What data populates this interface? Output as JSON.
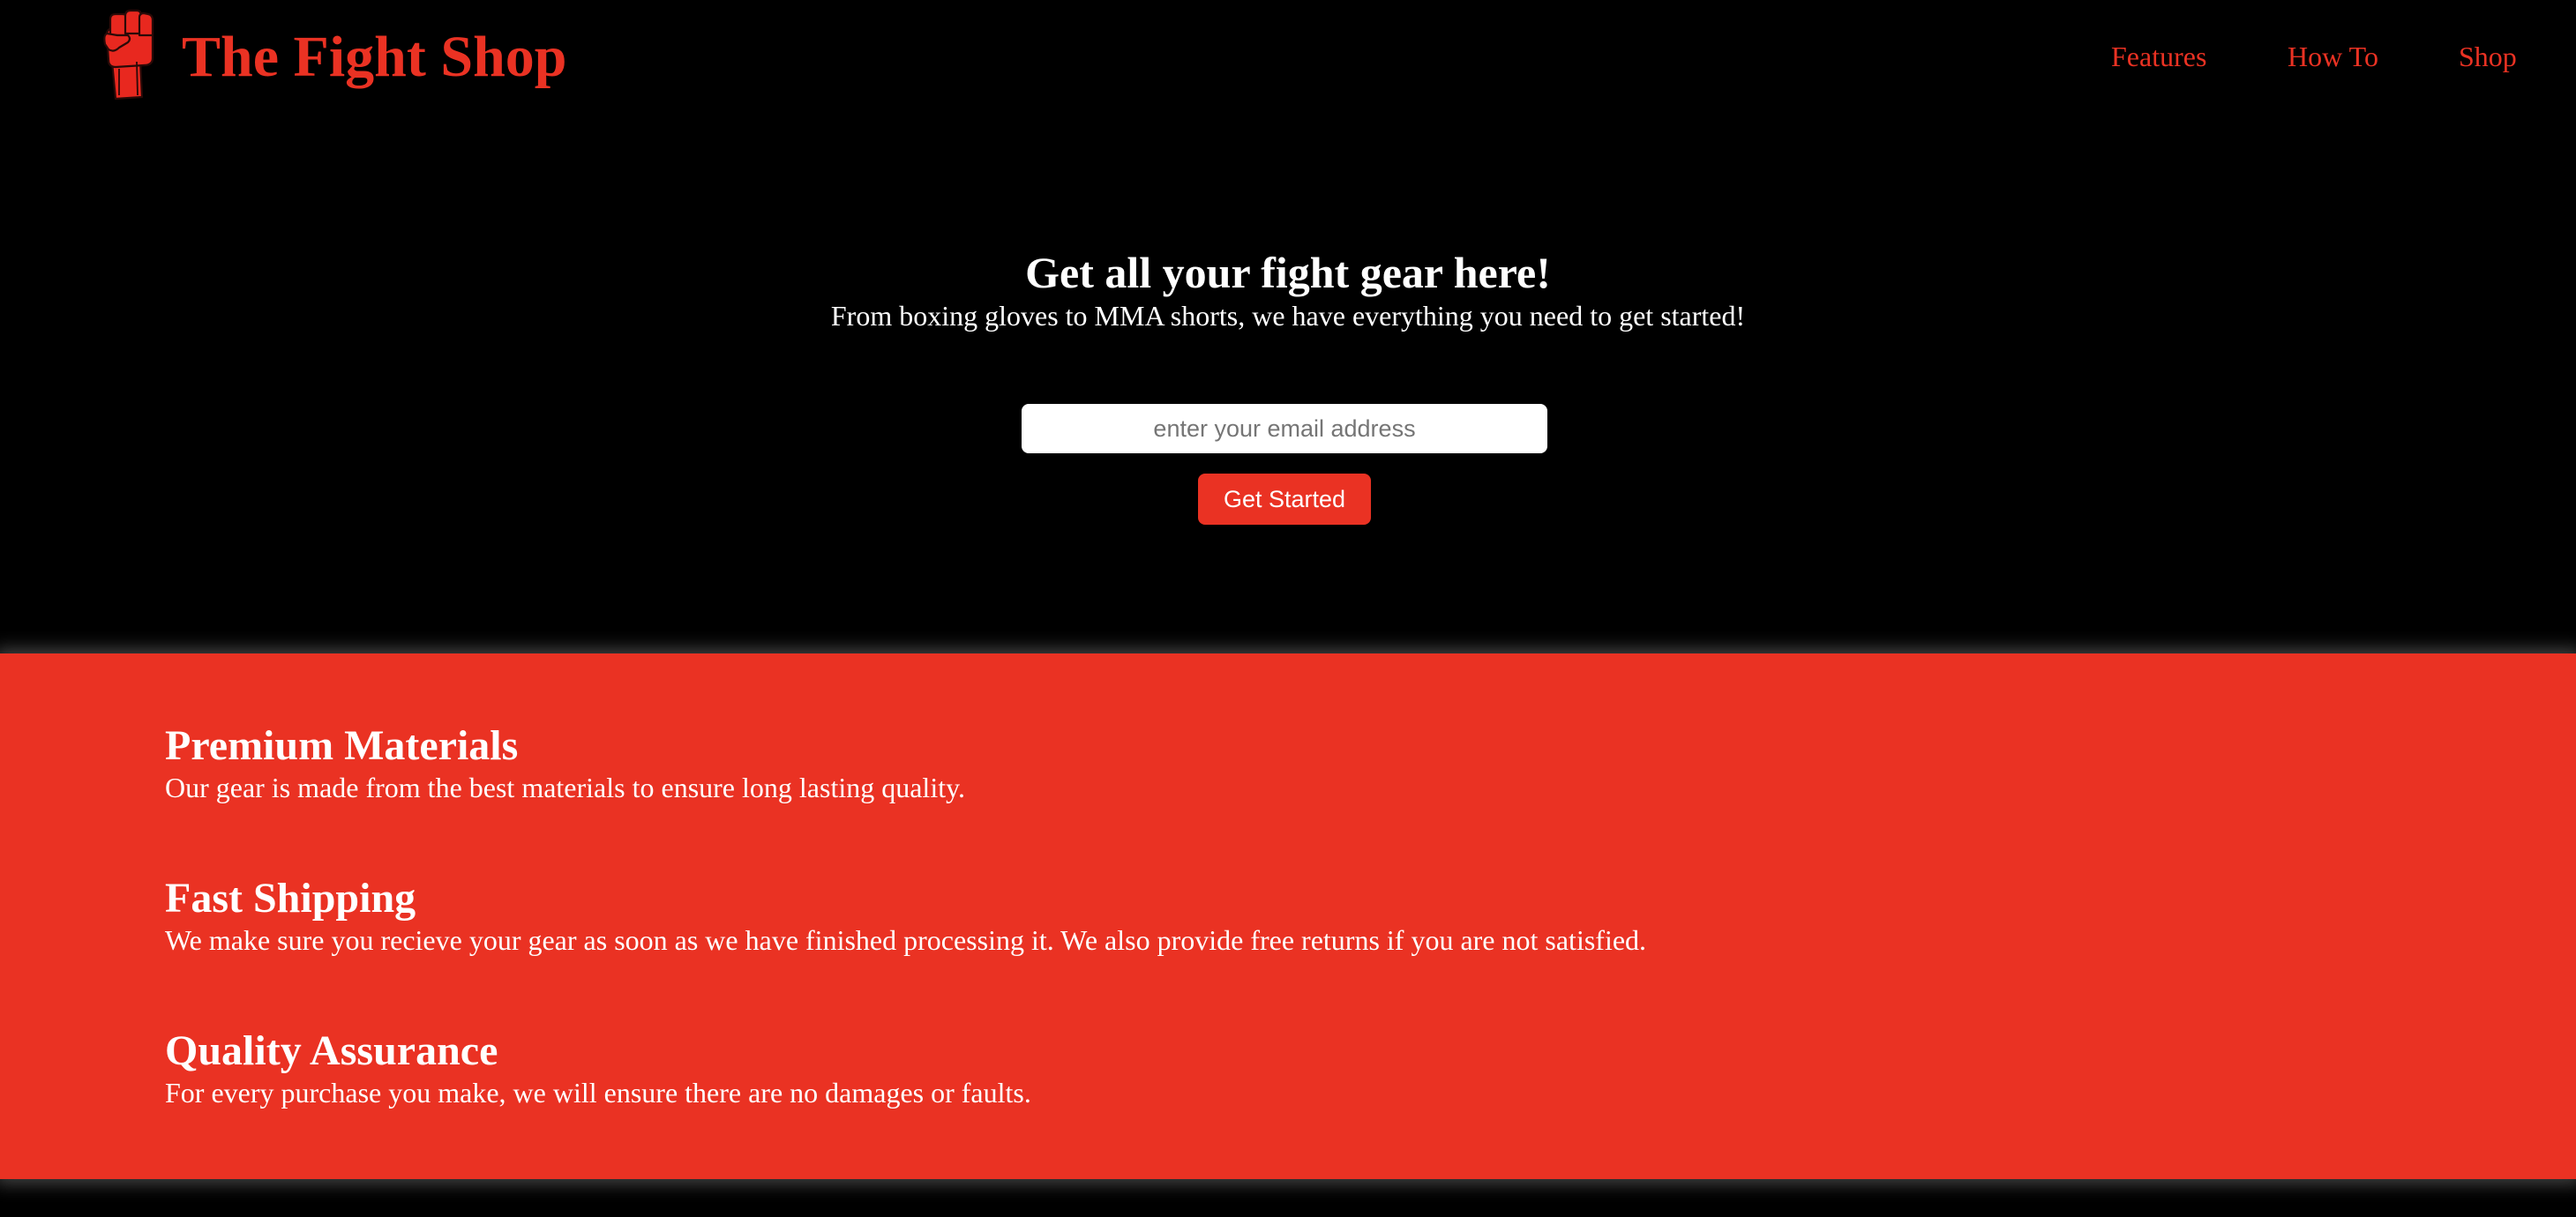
{
  "header": {
    "logo_icon": "raised-fist-icon",
    "title": "The Fight Shop",
    "nav": [
      {
        "label": "Features"
      },
      {
        "label": "How To"
      },
      {
        "label": "Shop"
      }
    ]
  },
  "hero": {
    "title": "Get all your fight gear here!",
    "subtitle": "From boxing gloves to MMA shorts, we have everything you need to get started!",
    "email_placeholder": "enter your email address",
    "email_value": "",
    "cta_label": "Get Started"
  },
  "features": [
    {
      "title": "Premium Materials",
      "text": "Our gear is made from the best materials to ensure long lasting quality."
    },
    {
      "title": "Fast Shipping",
      "text": "We make sure you recieve your gear as soon as we have finished processing it. We also provide free returns if you are not satisfied."
    },
    {
      "title": "Quality Assurance",
      "text": "For every purchase you make, we will ensure there are no damages or faults."
    }
  ],
  "colors": {
    "background": "#000000",
    "accent": "#ea3223",
    "text": "#ffffff"
  }
}
